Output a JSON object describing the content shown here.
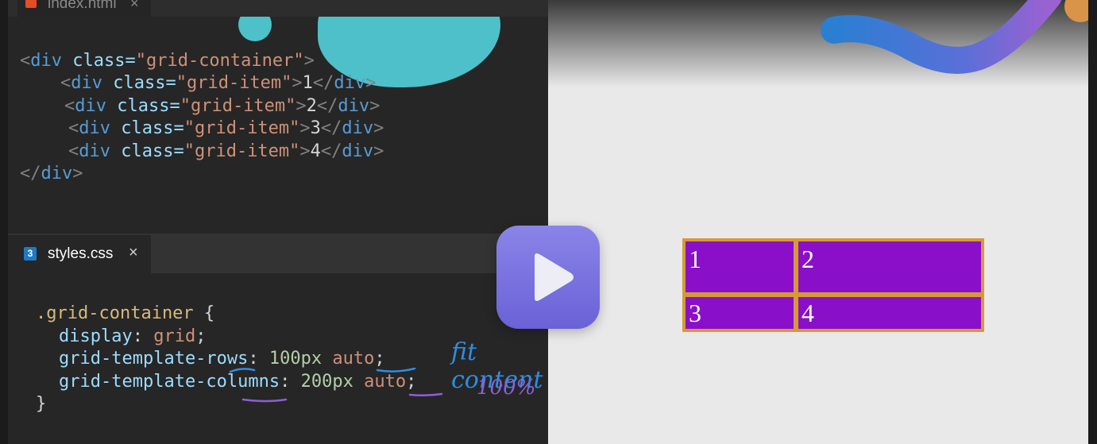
{
  "tabs": {
    "html_tab": {
      "label": "index.html",
      "close": "×"
    },
    "css_tab": {
      "label": "styles.css",
      "close": "×"
    }
  },
  "html_code": {
    "lines": [
      {
        "open": "<",
        "tag": "div",
        "attr": " class=",
        "str": "\"grid-container\"",
        "end": ">"
      },
      {
        "open": "<",
        "tag": "div",
        "attr": " class=",
        "str": "\"grid-item\"",
        "mid": ">",
        "text": "1",
        "close_open": "</",
        "close_tag": "div",
        "end": ">"
      },
      {
        "open": "<",
        "tag": "div",
        "attr": " class=",
        "str": "\"grid-item\"",
        "mid": ">",
        "text": "2",
        "close_open": "</",
        "close_tag": "div",
        "end": ">"
      },
      {
        "open": "<",
        "tag": "div",
        "attr": " class=",
        "str": "\"grid-item\"",
        "mid": ">",
        "text": "3",
        "close_open": "</",
        "close_tag": "div",
        "end": ">"
      },
      {
        "open": "<",
        "tag": "div",
        "attr": " class=",
        "str": "\"grid-item\"",
        "mid": ">",
        "text": "4",
        "close_open": "</",
        "close_tag": "div",
        "end": ">"
      },
      {
        "open": "</",
        "tag": "div",
        "end": ">"
      }
    ]
  },
  "css_code": {
    "selector": ".grid-container",
    "open_brace": " {",
    "decls": [
      {
        "prop": "display",
        "colon": ": ",
        "num": "",
        "val": "grid",
        "semi": ";"
      },
      {
        "prop": "grid-template-rows",
        "colon": ": ",
        "num": "100px ",
        "val": "auto",
        "semi": ";"
      },
      {
        "prop": "grid-template-columns",
        "colon": ": ",
        "num": "200px ",
        "val": "auto",
        "semi": ";"
      }
    ],
    "close_brace": "}"
  },
  "annotations": {
    "rows_note": "fit content",
    "columns_note": "100%"
  },
  "preview_grid": {
    "items": [
      "1",
      "2",
      "3",
      "4"
    ],
    "item_color": "#8a0fc9",
    "border_color": "#d69a35"
  },
  "colors": {
    "editor_bg": "#262626",
    "preview_bg": "#e9e9e9",
    "play_button": "#7b74e0",
    "accent_teal": "#4ec0c9",
    "annotation_blue": "#2f8de4",
    "annotation_purple": "#8e5fd6"
  },
  "icons": {
    "html_file": "html5-icon",
    "css_file": "css3-icon",
    "play": "play-icon"
  }
}
